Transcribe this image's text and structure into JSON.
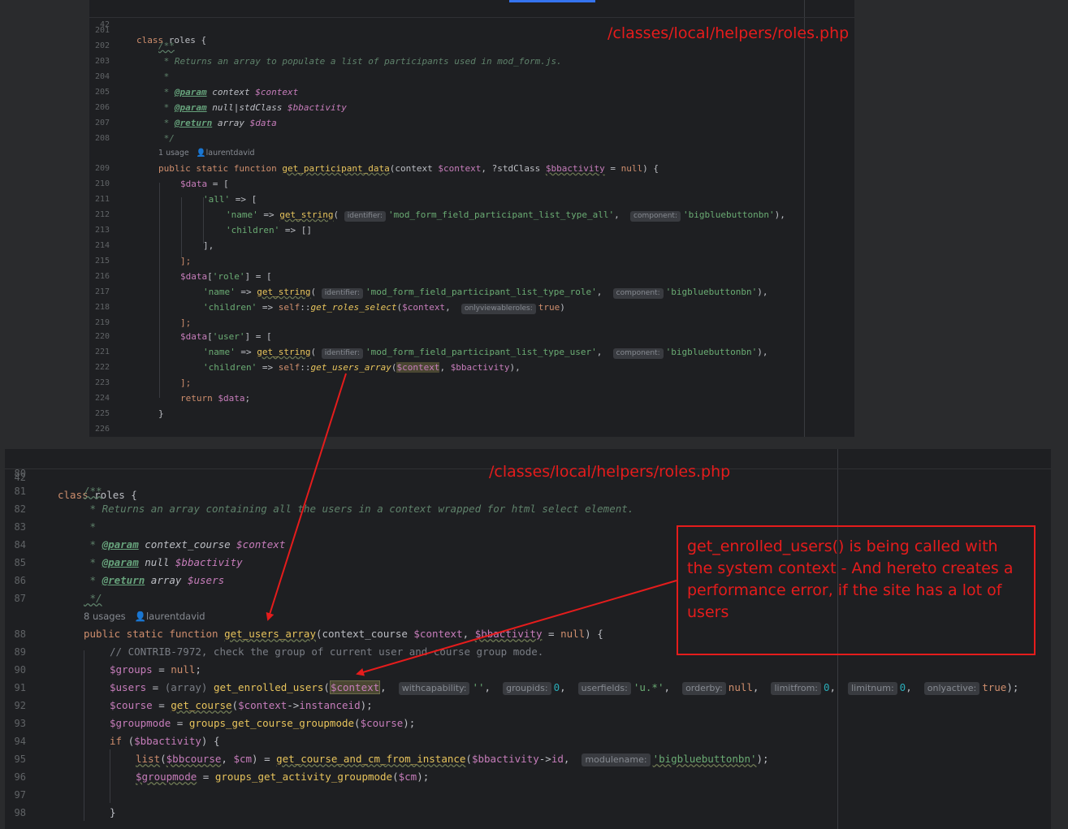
{
  "top_panel": {
    "sticky": {
      "num": "42",
      "text": "class roles {"
    },
    "file_label": "/classes/local/helpers/roles.php",
    "lens": {
      "usages": "1 usage",
      "author": "laurentdavid"
    },
    "lines": {
      "201": "201",
      "202": "202",
      "203": "203",
      "204": "204",
      "205": "205",
      "206": "206",
      "207": "207",
      "208": "208",
      "209": "209",
      "210": "210",
      "211": "211",
      "212": "212",
      "213": "213",
      "214": "214",
      "215": "215",
      "216": "216",
      "217": "217",
      "218": "218",
      "219": "219",
      "220": "220",
      "221": "221",
      "222": "222",
      "223": "223",
      "224": "224",
      "225": "225",
      "226": "226"
    },
    "doc_summary": " * Returns an array to populate a list of participants used in mod_form.js.",
    "doc_empty": " *",
    "param1_type": "context",
    "param1_var": "$context",
    "param2_type": "null|stdClass",
    "param2_var": "$bbactivity",
    "return_type": "array",
    "return_var": "$data",
    "method_name": "get_participant_data",
    "method_params_1": "(context ",
    "method_params_2": ", ?stdClass ",
    "method_params_3": " = ",
    "method_params_4": ") {",
    "str_all_id": "'mod_form_field_participant_list_type_all'",
    "str_role_id": "'mod_form_field_participant_list_type_role'",
    "str_user_id": "'mod_form_field_participant_list_type_user'",
    "str_component": "'bigbluebuttonbn'",
    "str_all": "'all'",
    "str_name": "'name'",
    "str_children": "'children'",
    "str_role": "'role'",
    "str_user": "'user'",
    "hint_identifier": "identifier:",
    "hint_component": "component:",
    "hint_onlyviewableroles": "onlyviewableroles:",
    "fn_get_roles_select": "get_roles_select",
    "fn_get_users_array": "get_users_array"
  },
  "bottom_panel": {
    "sticky": {
      "num": "42",
      "text": "class roles {"
    },
    "file_label": "/classes/local/helpers/roles.php",
    "lens": {
      "usages": "8 usages",
      "author": "laurentdavid"
    },
    "lines": {
      "80": "80",
      "81": "81",
      "82": "82",
      "83": "83",
      "84": "84",
      "85": "85",
      "86": "86",
      "87": "87",
      "88": "88",
      "89": "89",
      "90": "90",
      "91": "91",
      "92": "92",
      "93": "93",
      "94": "94",
      "95": "95",
      "96": "96",
      "97": "97",
      "98": "98"
    },
    "doc_summary": " * Returns an array containing all the users in a context wrapped for html select element.",
    "param1_type": "context_course",
    "param1_var": "$context",
    "param2_type": "null",
    "param2_var": "$bbactivity",
    "return_type": "array",
    "return_var": "$users",
    "method_name": "get_users_array",
    "comment": "// CONTRIB-7972, check the group of current user and course group mode.",
    "fn_get_enrolled_users": "get_enrolled_users",
    "fn_get_course": "get_course",
    "fn_groups_get_course_groupmode": "groups_get_course_groupmode",
    "fn_list": "list",
    "fn_get_course_and_cm": "get_course_and_cm_from_instance",
    "fn_groups_get_activity_groupmode": "groups_get_activity_groupmode",
    "hints": {
      "withcapability": "withcapability:",
      "groupids": "groupids:",
      "userfields": "userfields:",
      "orderby": "orderby:",
      "limitfrom": "limitfrom:",
      "limitnum": "limitnum:",
      "onlyactive": "onlyactive:",
      "modulename": "modulename:"
    },
    "str_userfields": "'u.*'",
    "str_empty": "''",
    "str_module": "'bigbluebuttonbn'"
  },
  "annotation": {
    "callout_text": "get_enrolled_users() is being called with the system context - And hereto creates a performance error, if the site has a lot of users",
    "color": "#e51c1c"
  },
  "theme": {
    "background": "#1e1f22",
    "keyword": "#cf8e6d",
    "function": "#56a8f5",
    "string": "#6aab73",
    "variable": "#c77dbb",
    "comment": "#7a7e85",
    "doc_comment": "#5f826b"
  }
}
